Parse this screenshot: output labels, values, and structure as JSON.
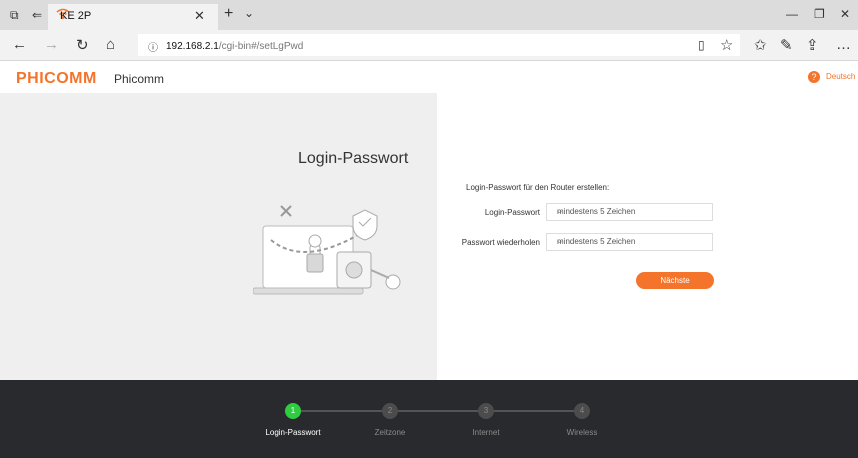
{
  "browser": {
    "tab_title": "KE 2P",
    "url_host": "192.168.2.1",
    "url_path": "/cgi-bin#/setLgPwd"
  },
  "header": {
    "logo": "PHICOMM",
    "brand": "Phicomm",
    "language": "Deutsch"
  },
  "left": {
    "title": "Login-Passwort"
  },
  "form": {
    "intro": "Login-Passwort für den Router erstellen:",
    "password_label": "Login-Passwort",
    "password_placeholder": "mindestens 5 Zeichen",
    "repeat_label": "Passwort wiederholen",
    "repeat_placeholder": "mindestens 5 Zeichen",
    "next_button": "Nächste"
  },
  "steps": [
    {
      "number": "1",
      "label": "Login-Passwort",
      "active": true
    },
    {
      "number": "2",
      "label": "Zeitzone",
      "active": false
    },
    {
      "number": "3",
      "label": "Internet",
      "active": false
    },
    {
      "number": "4",
      "label": "Wireless",
      "active": false
    }
  ],
  "colors": {
    "accent": "#f4742b",
    "step_active": "#2ecc40",
    "footer_bg": "#292a2e"
  }
}
